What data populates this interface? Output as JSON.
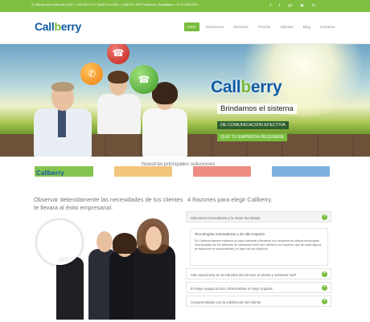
{
  "topbar": {
    "info": "✆ Oficinas Area California: 0001 • 1-800-007-5717 Tpl/88 Perú 0001 • 1-800-007-2007 Tcalifornia, Guadalajara • 33 78 3768 7801 •",
    "social": [
      "f",
      "t",
      "g+",
      "▶",
      "in"
    ]
  },
  "header": {
    "logo_a": "Call",
    "logo_b": "b",
    "logo_c": "erry",
    "nav": [
      "Inicio",
      "Soluciones",
      "Servicios",
      "Precios",
      "Clientes",
      "Blog",
      "Contacto"
    ]
  },
  "hero": {
    "logo_a": "Call",
    "logo_b": "b",
    "logo_c": "erry",
    "line1": "Brindamos el sistema",
    "line2": "DE COMUNICACION EFECTIVA",
    "line3": "QUE TU EMPRESA REQUIERE"
  },
  "band": {
    "text": "Nuestras principales soluciones",
    "card_logo": "Callberry"
  },
  "left": {
    "heading": "Observar detenidamente las necesidades de tus clientes te llevara al éxito empresarial."
  },
  "right": {
    "heading": "4 Razones para elegir Callberry.",
    "items": [
      "Soluciones innovadoras y la mejor tecnología",
      "Alta experiencia en la Industria del servicio al cliente y sistemas VoIP",
      "El mejor equipo técnico ofreciéndote el mejor soporte.",
      "Comprometidos con la satisfacción del cliente"
    ],
    "panel_title": "Tecnologías Innovadoras y de alto impacto",
    "panel_body": "En Callberry siempre estamos un paso adelante y llevamos a su empresa las últimas tecnologías relacionadas con los sistemas de interacción entre sus clientes y su empresa, que sin duda alguna se traducirán en productividad y el logro de sus objetivos."
  },
  "colors": {
    "brand_green": "#79bd3d",
    "brand_blue": "#0f5aa4"
  }
}
